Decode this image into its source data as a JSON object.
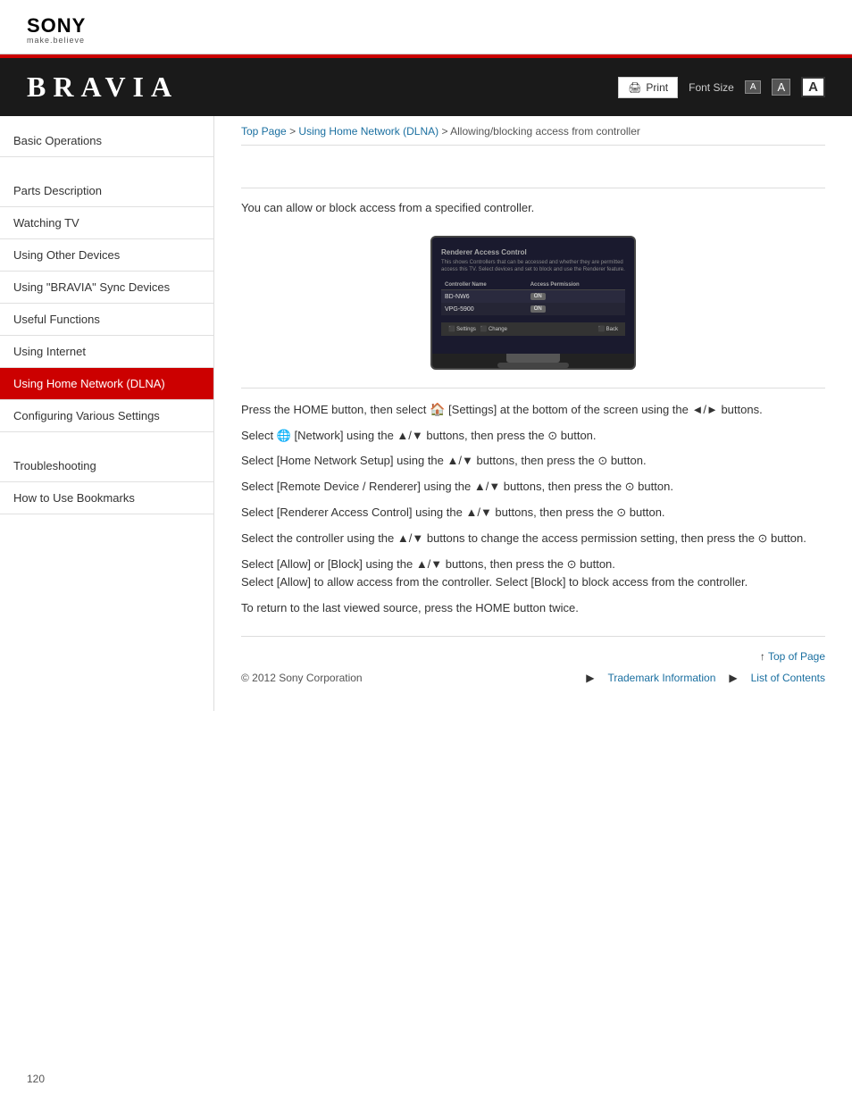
{
  "header": {
    "sony_logo": "SONY",
    "sony_tagline": "make.believe"
  },
  "brand_bar": {
    "title": "BRAVIA",
    "print_label": "Print",
    "font_size_label": "Font Size",
    "font_small_label": "A",
    "font_medium_label": "A",
    "font_large_label": "A"
  },
  "breadcrumb": {
    "top_page": "Top Page",
    "separator1": " > ",
    "using_home_network": "Using Home Network (DLNA)",
    "separator2": " > ",
    "current": "Allowing/blocking access from controller"
  },
  "sidebar": {
    "items": [
      {
        "id": "basic-operations",
        "label": "Basic Operations",
        "active": false
      },
      {
        "id": "parts-description",
        "label": "Parts Description",
        "active": false
      },
      {
        "id": "watching-tv",
        "label": "Watching TV",
        "active": false
      },
      {
        "id": "using-other-devices",
        "label": "Using Other Devices",
        "active": false
      },
      {
        "id": "using-bravia-sync",
        "label": "Using \"BRAVIA\" Sync Devices",
        "active": false
      },
      {
        "id": "useful-functions",
        "label": "Useful Functions",
        "active": false
      },
      {
        "id": "using-internet",
        "label": "Using Internet",
        "active": false
      },
      {
        "id": "using-home-network",
        "label": "Using Home Network (DLNA)",
        "active": true
      },
      {
        "id": "configuring-various-settings",
        "label": "Configuring Various Settings",
        "active": false
      },
      {
        "id": "troubleshooting",
        "label": "Troubleshooting",
        "active": false
      },
      {
        "id": "how-to-use-bookmarks",
        "label": "How to Use Bookmarks",
        "active": false
      }
    ]
  },
  "content": {
    "intro": "You can allow or block access from a specified controller.",
    "tv_screen": {
      "title": "Renderer Access Control",
      "subtitle": "This shows Controllers that can be accessed and whether they are permitted access this TV. Select devices and set to block and use the Renderer feature.",
      "table_headers": [
        "Controller Name",
        "Access Permission"
      ],
      "table_rows": [
        {
          "name": "BD-NW6",
          "permission": "ON"
        },
        {
          "name": "VPG-5900",
          "permission": "ON"
        }
      ],
      "footer_left": "Settings",
      "footer_right": "Back"
    },
    "instructions": [
      "Press the HOME button, then select 🏠 [Settings] at the bottom of the screen using the ◄/► buttons.",
      "Select 🌐 [Network] using the ▲/▼ buttons, then press the ⊙ button.",
      "Select [Home Network Setup] using the ▲/▼ buttons, then press the ⊙ button.",
      "Select [Remote Device / Renderer] using the ▲/▼ buttons, then press the ⊙ button.",
      "Select [Renderer Access Control] using the ▲/▼ buttons, then press the ⊙ button.",
      "Select the controller using the ▲/▼ buttons to change the access permission setting, then press the ⊙ button.",
      "Select [Allow] or [Block] using the ▲/▼ buttons, then press the ⊙ button.\nSelect [Allow] to allow access from the controller. Select [Block] to block access from the controller."
    ],
    "return_note": "To return to the last viewed source, press the HOME button twice."
  },
  "footer": {
    "top_of_page": "Top of Page",
    "copyright": "© 2012 Sony Corporation",
    "trademark": "Trademark Information",
    "list_of_contents": "List of Contents"
  },
  "page_number": "120"
}
